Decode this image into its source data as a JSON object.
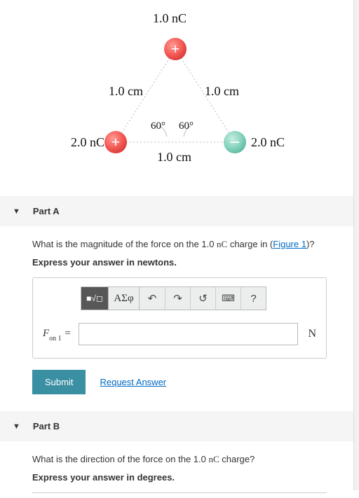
{
  "figure": {
    "topLabel": "1.0 nC",
    "leftSide": "1.0 cm",
    "rightSide": "1.0 cm",
    "angleLeft": "60°",
    "angleRight": "60°",
    "leftCharge": "2.0 nC",
    "rightCharge": "2.0 nC",
    "bottom": "1.0 cm",
    "topSign": "+",
    "leftSign": "+",
    "rightSign": "–"
  },
  "partA": {
    "title": "Part A",
    "prompt_pre": "What is the magnitude of the force on the 1.0 ",
    "prompt_unit": "nC",
    "prompt_post": " charge in (",
    "figure_link": "Figure 1",
    "prompt_close": ")?",
    "instruction": "Express your answer in newtons.",
    "toolbar": {
      "template": "■√◻",
      "greek": "ΑΣφ",
      "undo": "↶",
      "redo": "↷",
      "reset": "↺",
      "keyboard": "⌨",
      "help": "?"
    },
    "varPrefix": "F",
    "varSub": "on 1",
    "equals": " =",
    "unit": "N",
    "submit": "Submit",
    "request": "Request Answer"
  },
  "partB": {
    "title": "Part B",
    "prompt_pre": "What is the direction of the force on the 1.0 ",
    "prompt_unit": "nC",
    "prompt_post": " charge?",
    "instruction": "Express your answer in degrees."
  }
}
